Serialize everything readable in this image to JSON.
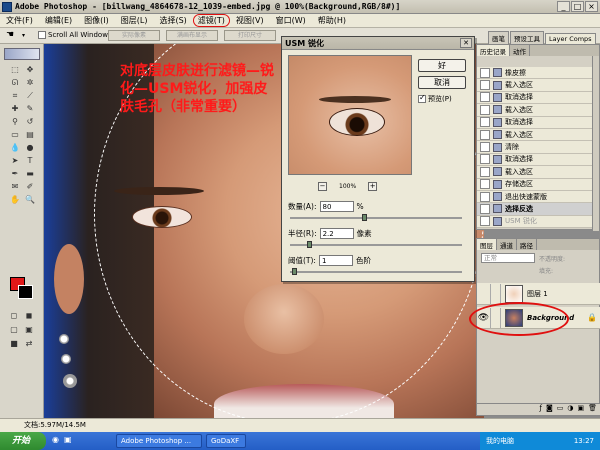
{
  "window": {
    "title": "Adobe Photoshop - [billwang_4864678-12_1039-embed.jpg @ 100%(Background,RGB/8#)]",
    "controls": [
      "_",
      "□",
      "×"
    ]
  },
  "menu": [
    "文件(F)",
    "编辑(E)",
    "图像(I)",
    "图层(L)",
    "选择(S)",
    "滤镜(T)",
    "视图(V)",
    "窗口(W)",
    "帮助(H)"
  ],
  "options_bar": {
    "scroll_all": "Scroll All Windows",
    "btn1": "实际像素",
    "btn2": "满画布显示",
    "btn3": "打印尺寸"
  },
  "palette_tabs": [
    "画笔",
    "预设工具",
    "Layer Comps"
  ],
  "annotation": "对底层皮肤进行滤镜—锐化—USM锐化，加强皮肤毛孔（非常重要）",
  "usm_dialog": {
    "title": "USM 锐化",
    "ok": "好",
    "cancel": "取消",
    "preview": "预览(P)",
    "zoom": "100%",
    "amount_label": "数量(A):",
    "amount_value": "80",
    "amount_unit": "%",
    "amount_fraction": 0.42,
    "radius_label": "半径(R):",
    "radius_value": "2.2",
    "radius_unit": "像素",
    "radius_fraction": 0.1,
    "threshold_label": "阈值(T):",
    "threshold_value": "1",
    "threshold_unit": "色阶",
    "threshold_fraction": 0.01
  },
  "history": {
    "tabs": [
      "历史记录",
      "动作"
    ],
    "items": [
      "橡皮擦",
      "载入选区",
      "取消选择",
      "载入选区",
      "取消选择",
      "载入选区",
      "清除",
      "取消选择",
      "载入选区",
      "存储选区",
      "退出快速蒙版",
      "选择反选",
      "USM 锐化"
    ]
  },
  "layers": {
    "tabs": [
      "图层",
      "通道",
      "路径"
    ],
    "mode": "正常",
    "opacity_label": "不透明度:",
    "fill_label": "填充:",
    "items": [
      "图层 1",
      "Background"
    ]
  },
  "status": "文档:5.97M/14.5M",
  "taskbar": {
    "start": "开始",
    "tasks": [
      "Adobe Photoshop ...",
      "GoDaXF"
    ],
    "tray_label": "我的电脑",
    "time": "13:27"
  }
}
